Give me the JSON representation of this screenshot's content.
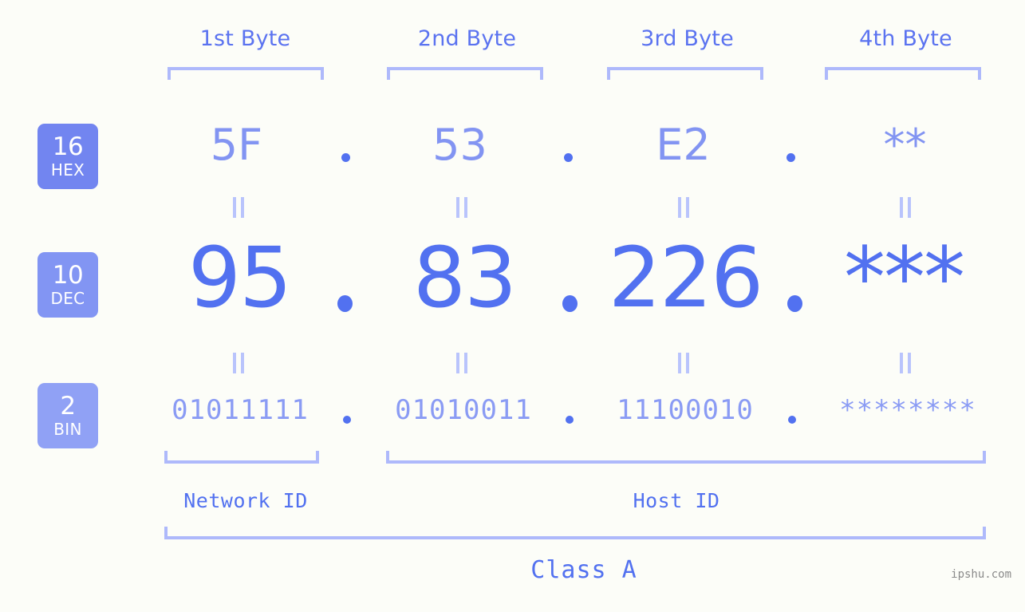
{
  "page": {
    "background": "#fcfdf8",
    "accent_strong": "#5271f0",
    "accent_mid": "#8294f2",
    "accent_light": "#aeb9fb",
    "watermark": "ipshu.com"
  },
  "byte_headers": [
    {
      "label": "1st Byte"
    },
    {
      "label": "2nd Byte"
    },
    {
      "label": "3rd Byte"
    },
    {
      "label": "4th Byte"
    }
  ],
  "rows": [
    {
      "badge_number": "16",
      "badge_abbr": "HEX",
      "badge_color": "#7285f0",
      "values": [
        "5F",
        "53",
        "E2",
        "**"
      ],
      "separator": "."
    },
    {
      "badge_number": "10",
      "badge_abbr": "DEC",
      "badge_color": "#8295f3",
      "values": [
        "95",
        "83",
        "226",
        "***"
      ],
      "separator": "."
    },
    {
      "badge_number": "2",
      "badge_abbr": "BIN",
      "badge_color": "#90a1f5",
      "values": [
        "01011111",
        "01010011",
        "11100010",
        "********"
      ],
      "separator": "."
    }
  ],
  "segments": {
    "network_id": "Network ID",
    "host_id": "Host ID",
    "class": "Class A"
  }
}
